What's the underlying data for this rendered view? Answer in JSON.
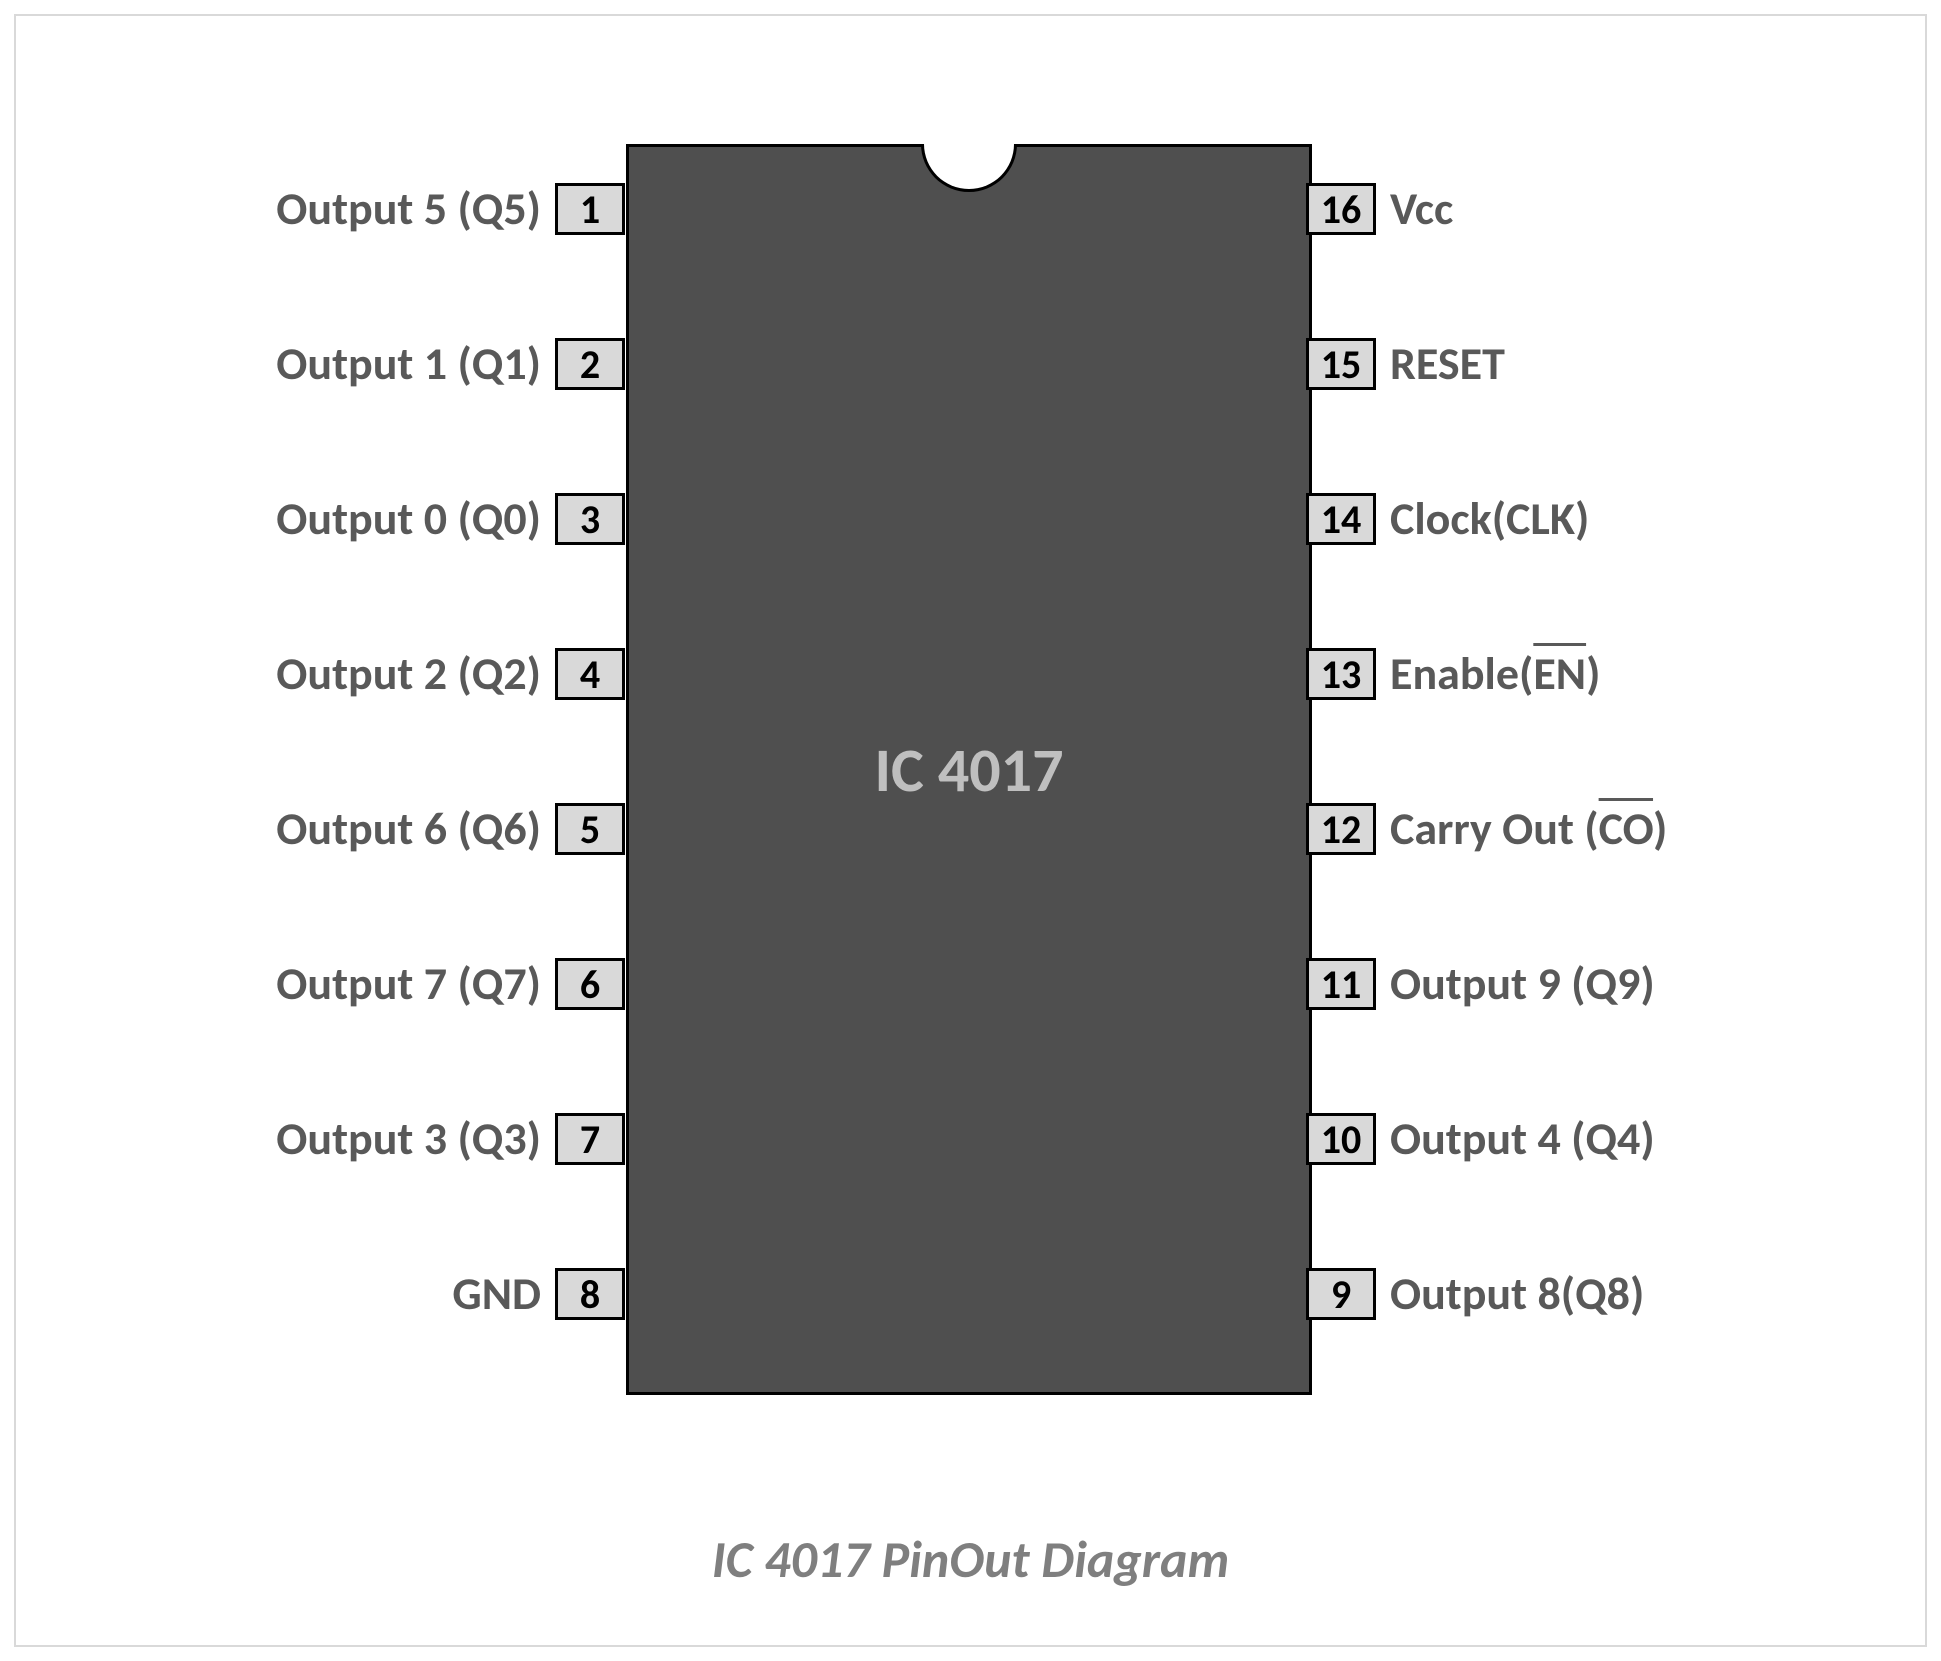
{
  "chip_name": "IC 4017",
  "caption": "IC 4017 PinOut Diagram",
  "left_pins": [
    {
      "num": "1",
      "label": "Output 5 (Q5)"
    },
    {
      "num": "2",
      "label": "Output 1 (Q1)"
    },
    {
      "num": "3",
      "label": "Output 0 (Q0)"
    },
    {
      "num": "4",
      "label": "Output 2 (Q2)"
    },
    {
      "num": "5",
      "label": "Output 6 (Q6)"
    },
    {
      "num": "6",
      "label": "Output 7 (Q7)"
    },
    {
      "num": "7",
      "label": "Output 3 (Q3)"
    },
    {
      "num": "8",
      "label": "GND"
    }
  ],
  "right_pins": [
    {
      "num": "16",
      "label": "Vcc"
    },
    {
      "num": "15",
      "label": "RESET"
    },
    {
      "num": "14",
      "label": "Clock(CLK)"
    },
    {
      "num": "13",
      "label_pre": "Enable(",
      "label_ov": "EN",
      "label_post": ")"
    },
    {
      "num": "12",
      "label_pre": "Carry Out (",
      "label_ov": "CO",
      "label_post": ")"
    },
    {
      "num": "11",
      "label": "Output 9 (Q9)"
    },
    {
      "num": "10",
      "label": "Output 4 (Q4)"
    },
    {
      "num": "9",
      "label": "Output 8(Q8)"
    }
  ],
  "chart_data": {
    "type": "table",
    "title": "IC 4017 PinOut Diagram",
    "pins": [
      {
        "pin": 1,
        "name": "Output 5 (Q5)"
      },
      {
        "pin": 2,
        "name": "Output 1 (Q1)"
      },
      {
        "pin": 3,
        "name": "Output 0 (Q0)"
      },
      {
        "pin": 4,
        "name": "Output 2 (Q2)"
      },
      {
        "pin": 5,
        "name": "Output 6 (Q6)"
      },
      {
        "pin": 6,
        "name": "Output 7 (Q7)"
      },
      {
        "pin": 7,
        "name": "Output 3 (Q3)"
      },
      {
        "pin": 8,
        "name": "GND"
      },
      {
        "pin": 9,
        "name": "Output 8 (Q8)"
      },
      {
        "pin": 10,
        "name": "Output 4 (Q4)"
      },
      {
        "pin": 11,
        "name": "Output 9 (Q9)"
      },
      {
        "pin": 12,
        "name": "Carry Out (CO, active low)"
      },
      {
        "pin": 13,
        "name": "Enable (EN, active low)"
      },
      {
        "pin": 14,
        "name": "Clock (CLK)"
      },
      {
        "pin": 15,
        "name": "RESET"
      },
      {
        "pin": 16,
        "name": "Vcc"
      }
    ]
  }
}
